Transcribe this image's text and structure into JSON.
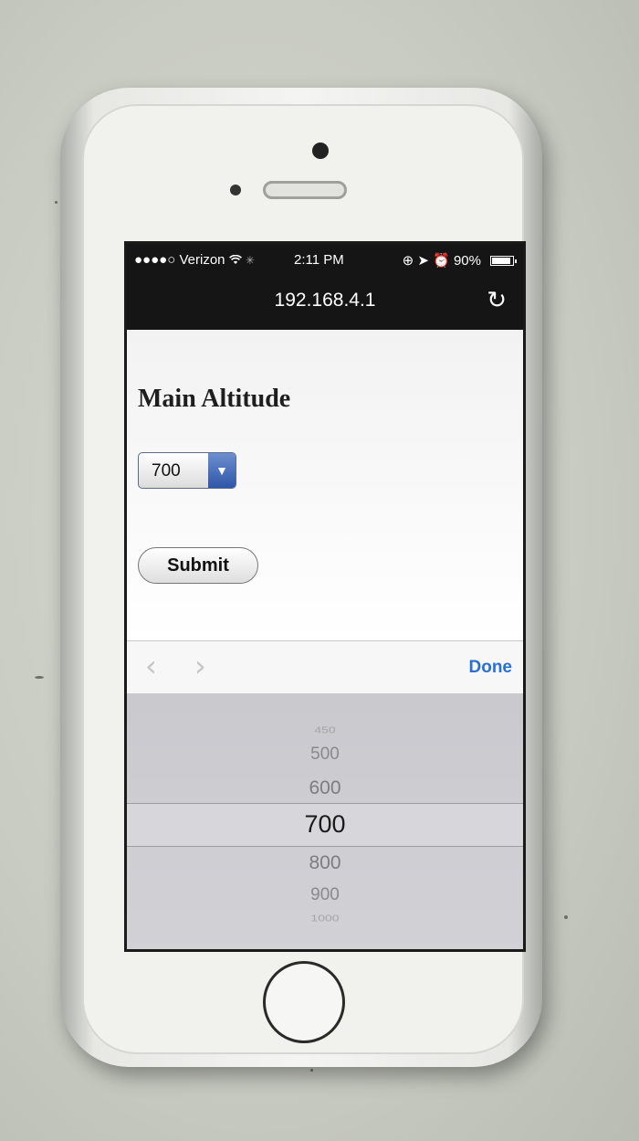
{
  "status_bar": {
    "carrier": "●●●●○ Verizon",
    "wifi_icon": "wifi-icon",
    "time": "2:11 PM",
    "indicators": "⊕ ➤ ⏰",
    "battery_percent": "90%",
    "battery_level": 0.9
  },
  "browser": {
    "url": "192.168.4.1",
    "reload_glyph": "↻"
  },
  "page": {
    "heading": "Main Altitude",
    "select_value": "700",
    "submit_label": "Submit"
  },
  "toolbar": {
    "prev_glyph": "‹",
    "next_glyph": "›",
    "done_label": "Done"
  },
  "picker": {
    "options": [
      "450",
      "500",
      "600",
      "700",
      "800",
      "900",
      "1000"
    ],
    "selected": "700"
  },
  "colors": {
    "accent_blue": "#2a6fd6",
    "select_arrow": "#2f56a9"
  }
}
